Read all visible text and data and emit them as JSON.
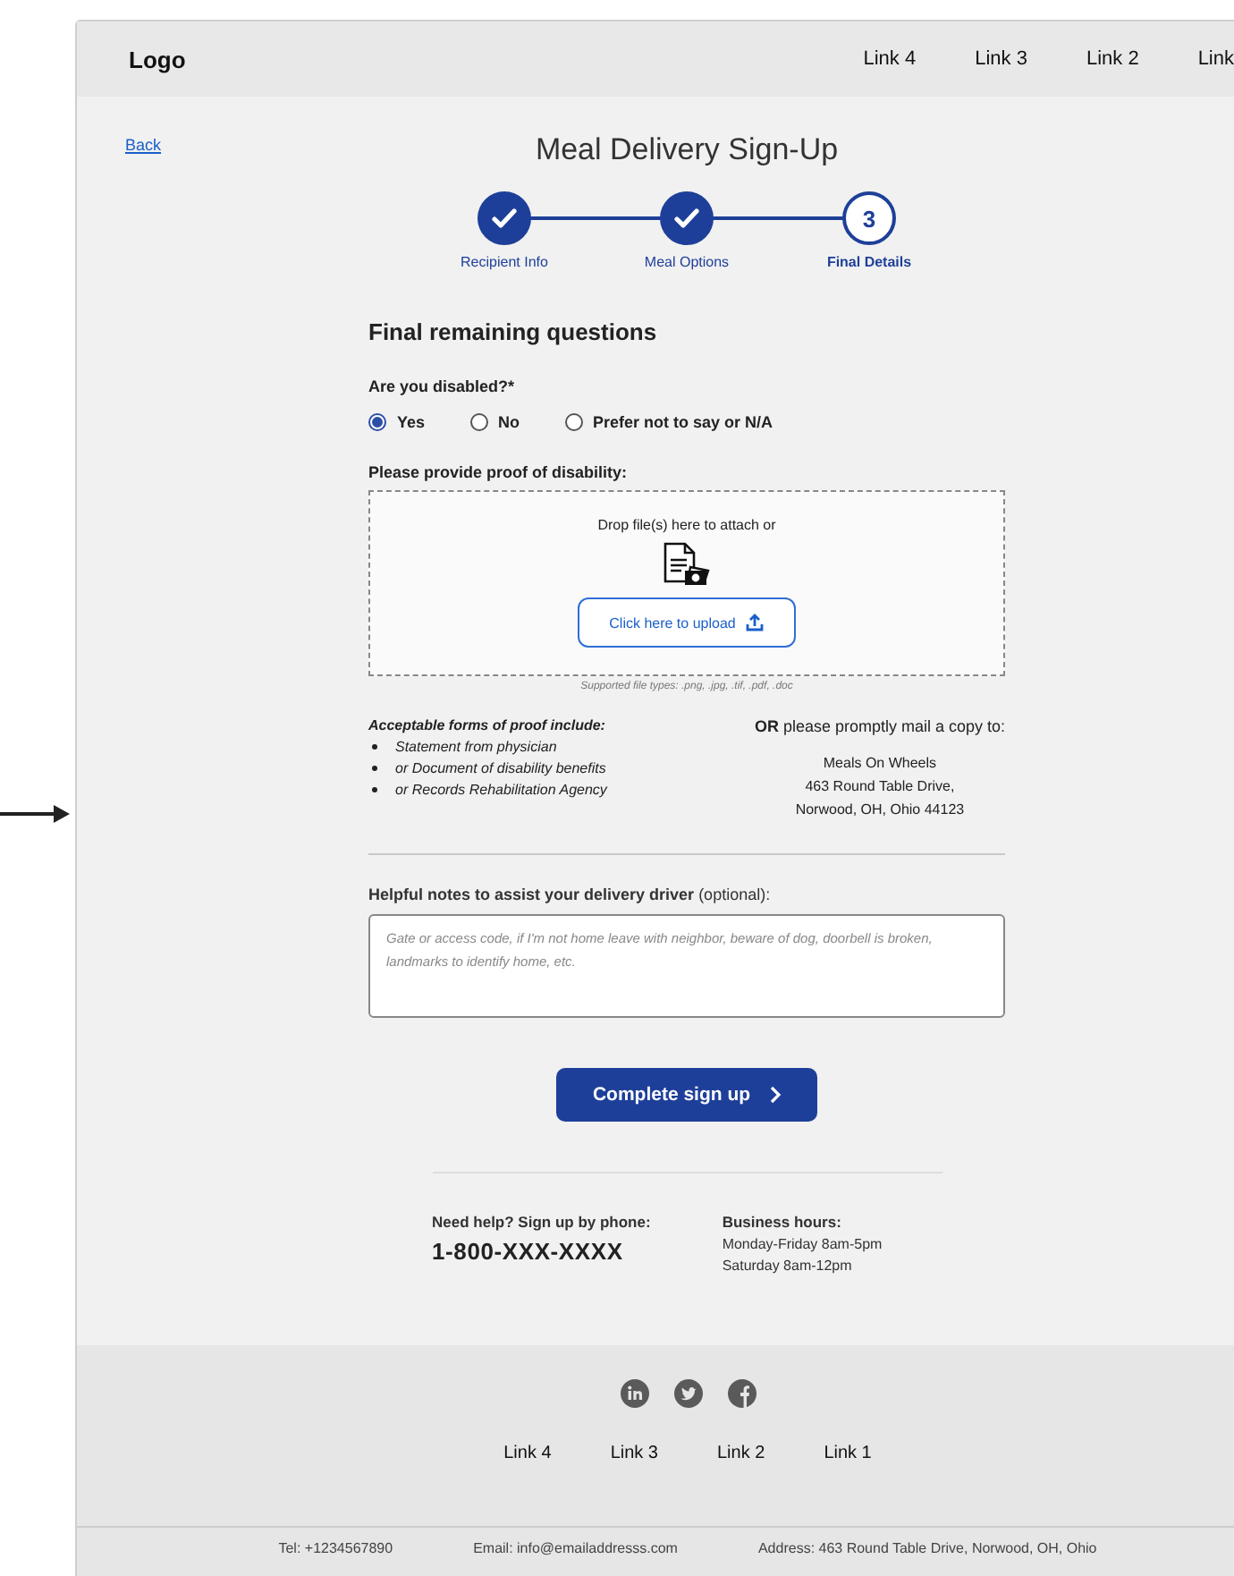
{
  "header": {
    "logo": "Logo",
    "links": [
      "Link 4",
      "Link 3",
      "Link 2",
      "Link"
    ]
  },
  "back_link": "Back",
  "title": "Meal Delivery Sign-Up",
  "steps": [
    {
      "label": "Recipient Info",
      "completed": true,
      "selected": false
    },
    {
      "label": "Meal Options",
      "completed": true,
      "selected": false
    },
    {
      "label": "Final Details",
      "number": "3",
      "completed": false,
      "selected": true
    }
  ],
  "section_title": "Final remaining questions",
  "question": "Are you disabled?*",
  "options": [
    {
      "label": "Yes",
      "selected": true
    },
    {
      "label": "No",
      "selected": false
    },
    {
      "label": "Prefer not to say or N/A",
      "selected": false
    }
  ],
  "proof_label": "Please provide proof of disability:",
  "dropzone": {
    "text": "Drop file(s) here to attach or",
    "button": "Click here to upload",
    "supported": "Supported file types: .png, .jpg, .tif, .pdf, .doc"
  },
  "acceptable": {
    "title": "Acceptable forms of proof include:",
    "items": [
      "Statement from physician",
      "or Document of disability benefits",
      "or Records Rehabilitation Agency"
    ]
  },
  "mail": {
    "title": "**OR** please promptly mail a copy to:",
    "address": [
      "Meals On Wheels",
      "463 Round Table Drive,",
      "Norwood, OH, Ohio 44123"
    ]
  },
  "notes": {
    "label": "**Helpful notes to assist your delivery driver** (optional):",
    "placeholder": "Gate or access code, if I'm not home leave with neighbor, beware of dog, doorbell is broken, landmarks to identify home, etc."
  },
  "submit": "Complete sign up",
  "help": {
    "title": "Need help? Sign up by phone:",
    "phone": "1-800-XXX-XXXX",
    "hours_title": "Business hours:",
    "hours": [
      "Monday-Friday 8am-5pm",
      "Saturday 8am-12pm"
    ]
  },
  "footer": {
    "social": [
      {
        "kind": "linkedin"
      },
      {
        "kind": "twitter"
      },
      {
        "kind": "facebook"
      }
    ],
    "links": [
      "Link 4",
      "Link 3",
      "Link 2",
      "Link 1"
    ],
    "contact": [
      "Tel:  +1234567890",
      "Email: info@emailaddresss.com",
      "Address: 463 Round Table Drive, Norwood, OH, Ohio"
    ]
  }
}
